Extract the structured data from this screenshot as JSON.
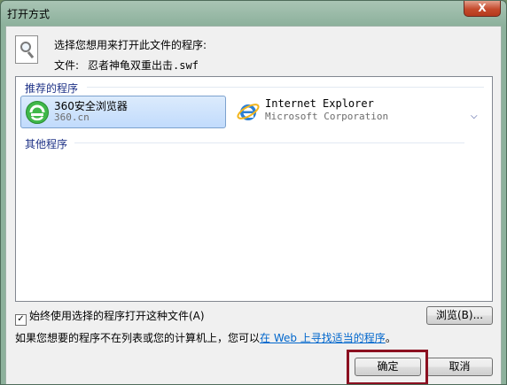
{
  "window": {
    "title": "打开方式",
    "close_label": "X"
  },
  "header": {
    "prompt": "选择您想用来打开此文件的程序:",
    "file_label": "文件:",
    "file_name": "忍者神龟双重出击.swf"
  },
  "groups": {
    "recommended_label": "推荐的程序",
    "other_label": "其他程序"
  },
  "programs": [
    {
      "name": "360安全浏览器",
      "publisher": "360.cn",
      "icon": "360-browser-icon",
      "selected": true
    },
    {
      "name": "Internet Explorer",
      "publisher": "Microsoft Corporation",
      "icon": "internet-explorer-icon",
      "selected": false
    }
  ],
  "options": {
    "always_use_label": "始终使用选择的程序打开这种文件(A)",
    "always_use_checked": true,
    "browse_label": "浏览(B)..."
  },
  "notice": {
    "before": "如果您想要的程序不在列表或您的计算机上，您可以",
    "link": "在 Web 上寻找适当的程序",
    "after": "。"
  },
  "buttons": {
    "ok_label": "确定",
    "cancel_label": "取消"
  },
  "colors": {
    "link": "#0066cc",
    "group_heading": "#1e3287",
    "focus_box": "#8b1020"
  }
}
